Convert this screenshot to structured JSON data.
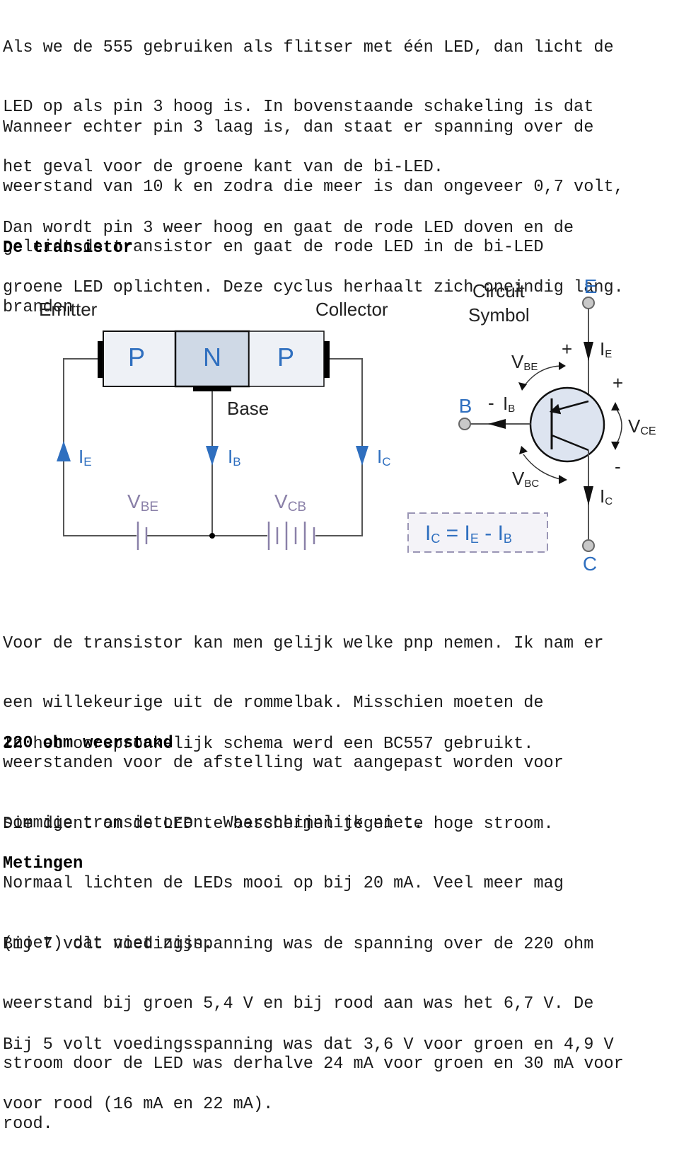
{
  "paragraphs": {
    "p1": [
      "Als we de 555 gebruiken als flitser met één LED, dan licht de",
      "LED op als pin 3 hoog is. In bovenstaande schakeling is dat",
      "het geval voor de groene kant van de bi-LED."
    ],
    "p2": [
      "Wanneer echter pin 3 laag is, dan staat er spanning over de",
      "weerstand van 10 k en zodra die meer is dan ongeveer 0,7 volt,",
      "geleidt de transistor en gaat de rode LED in de bi-LED",
      "branden."
    ],
    "p3": [
      "Dan wordt pin 3 weer hoog en gaat de rode LED doven en de",
      "groene LED oplichten. Deze cyclus herhaalt zich oneindig lang."
    ],
    "p4": [
      "Voor de transistor kan men gelijk welke pnp nemen. Ik nam er",
      "een willekeurige uit de rommelbak. Misschien moeten de",
      "weerstanden voor de afstelling wat aangepast worden voor",
      "sommige transistoren. Waarschijnlijk niet."
    ],
    "p5": [
      "In het oorspronkelijk schema werd een BC557 gebruikt."
    ],
    "p6": [
      "Die dient om de LED te beschermen tegen te hoge stroom.",
      "Normaal lichten de LEDs mooi op bij 20 mA. Veel meer mag",
      "(moet) dat niet zijn."
    ],
    "p7": [
      "Bij 7 volt voedingsspanning was de spanning over de 220 ohm",
      "weerstand bij groen 5,4 V en bij rood aan was het 6,7 V. De",
      "stroom door de LED was derhalve 24 mA voor groen en 30 mA voor",
      "rood."
    ],
    "p8": [
      "Bij 5 volt voedingsspanning was dat 3,6 V voor groen en 4,9 V",
      "voor rood (16 mA en 22 mA)."
    ]
  },
  "headings": {
    "transistor": "De transistor",
    "resistor": "220 ohm weerstand",
    "measurements": "Metingen"
  },
  "diagram": {
    "emitter_label": "Emitter",
    "collector_label": "Collector",
    "base_label": "Base",
    "regions": [
      "P",
      "N",
      "P"
    ],
    "ie": {
      "main": "I",
      "sub": "E"
    },
    "ib": {
      "main": "I",
      "sub": "B"
    },
    "ic": {
      "main": "I",
      "sub": "C"
    },
    "vbe": {
      "main": "V",
      "sub": "BE"
    },
    "vcb": {
      "main": "V",
      "sub": "CB"
    },
    "vce": {
      "main": "V",
      "sub": "CE"
    },
    "vbc": {
      "main": "V",
      "sub": "BC"
    },
    "symbol_title_1": "Circuit",
    "symbol_title_2": "Symbol",
    "terminal_e": "E",
    "terminal_b": "B",
    "terminal_c": "C",
    "plus": "+",
    "minus": "-",
    "formula": {
      "ic": "C",
      "eq": " = ",
      "ie": "E",
      "minus": " - ",
      "ib": "B"
    },
    "colors": {
      "accent_blue": "#2f6fbf",
      "purple": "#8a80a8",
      "n_region": "#cfd9e6",
      "p_region": "#eef1f6",
      "symbol_fill": "#dde4f0"
    }
  }
}
